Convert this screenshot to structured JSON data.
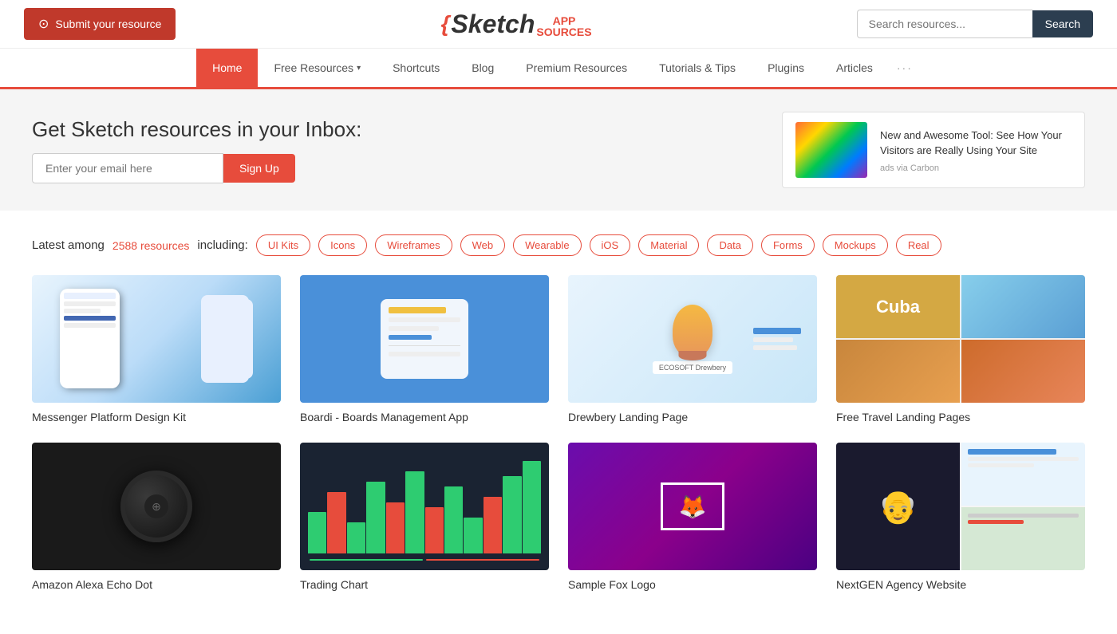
{
  "header": {
    "submit_label": "Submit your resource",
    "logo_sketch": "Sketch",
    "logo_app": "APP",
    "logo_sources": "SOURCES",
    "search_placeholder": "Search resources...",
    "search_button_label": "Search"
  },
  "nav": {
    "items": [
      {
        "id": "home",
        "label": "Home",
        "active": true,
        "has_arrow": false
      },
      {
        "id": "free-resources",
        "label": "Free Resources",
        "active": false,
        "has_arrow": true
      },
      {
        "id": "shortcuts",
        "label": "Shortcuts",
        "active": false,
        "has_arrow": false
      },
      {
        "id": "blog",
        "label": "Blog",
        "active": false,
        "has_arrow": false
      },
      {
        "id": "premium-resources",
        "label": "Premium Resources",
        "active": false,
        "has_arrow": false
      },
      {
        "id": "tutorials",
        "label": "Tutorials & Tips",
        "active": false,
        "has_arrow": false
      },
      {
        "id": "plugins",
        "label": "Plugins",
        "active": false,
        "has_arrow": false
      },
      {
        "id": "articles",
        "label": "Articles",
        "active": false,
        "has_arrow": false
      }
    ],
    "dots_label": "···"
  },
  "banner": {
    "title": "Get Sketch resources in your Inbox:",
    "email_placeholder": "Enter your email here",
    "signup_label": "Sign Up",
    "ad_title": "New and Awesome Tool: See How Your Visitors are Really Using Your Site",
    "ad_via": "ads via Carbon"
  },
  "resources": {
    "intro": "Latest among",
    "count": "2588 resources",
    "including": "including:",
    "tags": [
      "UI Kits",
      "Icons",
      "Wireframes",
      "Web",
      "Wearable",
      "iOS",
      "Material",
      "Data",
      "Forms",
      "Mockups",
      "Real"
    ]
  },
  "cards_row1": [
    {
      "id": "messenger",
      "title": "Messenger Platform Design Kit",
      "type": "messenger"
    },
    {
      "id": "boardi",
      "title": "Boardi - Boards Management App",
      "type": "boardi"
    },
    {
      "id": "drewbery",
      "title": "Drewbery Landing Page",
      "type": "drewbery"
    },
    {
      "id": "cuba",
      "title": "Free Travel Landing Pages",
      "type": "cuba"
    }
  ],
  "cards_row2": [
    {
      "id": "alexa",
      "title": "Amazon Alexa Echo Dot",
      "type": "alexa"
    },
    {
      "id": "trading",
      "title": "Trading Chart",
      "type": "trading"
    },
    {
      "id": "animal",
      "title": "Sample Fox Logo",
      "type": "animal"
    },
    {
      "id": "nextgen",
      "title": "NextGEN Agency Website",
      "type": "nextgen"
    }
  ],
  "colors": {
    "accent": "#e74c3c",
    "dark": "#2c3e50"
  }
}
